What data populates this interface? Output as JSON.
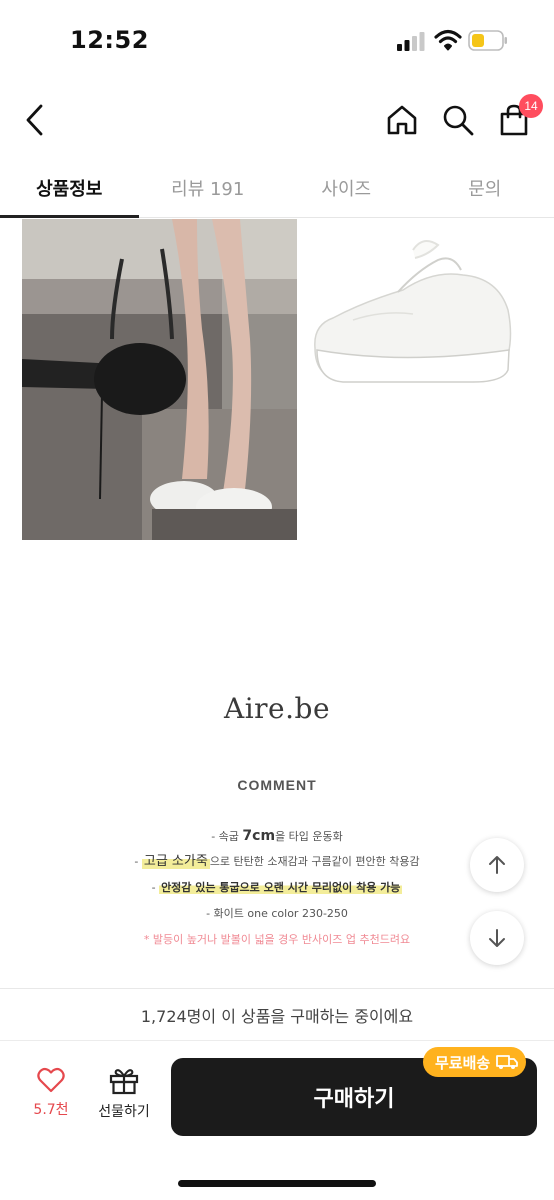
{
  "status_bar": {
    "time": "12:52",
    "icons": [
      "cellular-signal-icon",
      "wifi-icon",
      "battery-icon"
    ],
    "battery_color": "#f5c518"
  },
  "nav": {
    "icons": [
      "back-chevron-icon",
      "home-icon",
      "search-icon",
      "shopping-bag-icon"
    ],
    "cart_badge": "14",
    "badge_color": "#ff4d5e"
  },
  "tabs": [
    {
      "label": "상품정보",
      "active": true
    },
    {
      "label": "리뷰 191",
      "active": false
    },
    {
      "label": "사이즈",
      "active": false
    },
    {
      "label": "문의",
      "active": false
    }
  ],
  "product": {
    "brand": "Aire.be",
    "comment_title": "COMMENT",
    "comment": {
      "line1_pre": "- 속굽 ",
      "line1_strong": "7cm",
      "line1_post": "을 타입 운동화",
      "line2_pre": "- ",
      "line2_highlight": "고급 소가죽",
      "line2_post": "으로 탄탄한 소재감과 구름같이 편안한 착용감",
      "line3_pre": "- ",
      "line3_highlight": "안정감 있는 통굽으로 오랜 시간 무리없이 착용 가능",
      "line4": "- 화이트 one color 230-250",
      "line5": "* 발등이 높거나 발볼이 넓을 경우 반사이즈 업 추천드려요"
    }
  },
  "floating": {
    "icons": [
      "arrow-up-icon",
      "arrow-down-icon"
    ]
  },
  "bottom": {
    "notice": "1,724명이 이 상품을 구매하는 중이에요",
    "like_count": "5.7천",
    "gift_label": "선물하기",
    "buy_label": "구매하기",
    "free_shipping": "무료배송",
    "accent_color": "#ffb21e",
    "like_color": "#e5484d"
  }
}
